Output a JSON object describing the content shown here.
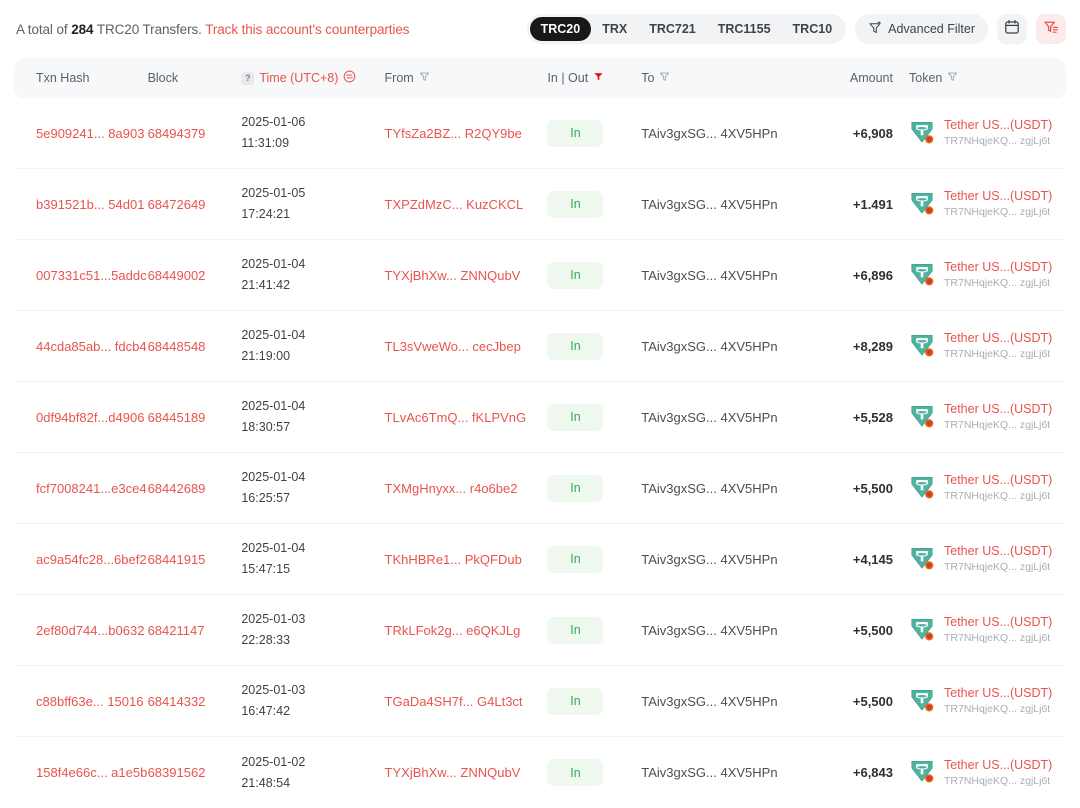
{
  "summary": {
    "prefix": "A total of",
    "count": "284",
    "middle": "TRC20 Transfers.",
    "link": "Track this account's counterparties"
  },
  "toolbar": {
    "tabs": [
      {
        "label": "TRC20",
        "active": true
      },
      {
        "label": "TRX",
        "active": false
      },
      {
        "label": "TRC721",
        "active": false
      },
      {
        "label": "TRC1155",
        "active": false
      },
      {
        "label": "TRC10",
        "active": false
      }
    ],
    "advanced_filter_label": "Advanced Filter",
    "advanced_filter_icon": "funnel-icon",
    "calendar_icon": "calendar-icon",
    "filter_list_icon": "filter-list-icon"
  },
  "colors": {
    "accent_red": "#e8544d",
    "badge_green_bg": "#eef8ef",
    "badge_green_text": "#3aa757",
    "header_bg": "#f7f8f9",
    "tab_active_bg": "#17181a"
  },
  "table": {
    "headers": {
      "txn_hash": "Txn Hash",
      "block": "Block",
      "time": "Time (UTC+8)",
      "time_help": "?",
      "from": "From",
      "in_out": "In | Out",
      "to": "To",
      "amount": "Amount",
      "token": "Token"
    },
    "rows": [
      {
        "hash": "5e909241... 8a903",
        "block": "68494379",
        "date": "2025-01-06",
        "time": "11:31:09",
        "from": "TYfsZa2BZ... R2QY9be",
        "direction": "In",
        "to": "TAiv3gxSG... 4XV5HPn",
        "amount": "+6,908",
        "token_name": "Tether US...(USDT)",
        "token_addr": "TR7NHqjeKQ... zgjLj6t"
      },
      {
        "hash": "b391521b... 54d01",
        "block": "68472649",
        "date": "2025-01-05",
        "time": "17:24:21",
        "from": "TXPZdMzC... KuzCKCL",
        "direction": "In",
        "to": "TAiv3gxSG... 4XV5HPn",
        "amount": "+1.491",
        "token_name": "Tether US...(USDT)",
        "token_addr": "TR7NHqjeKQ... zgjLj6t"
      },
      {
        "hash": "007331c51...5addc",
        "block": "68449002",
        "date": "2025-01-04",
        "time": "21:41:42",
        "from": "TYXjBhXw... ZNNQubV",
        "direction": "In",
        "to": "TAiv3gxSG... 4XV5HPn",
        "amount": "+6,896",
        "token_name": "Tether US...(USDT)",
        "token_addr": "TR7NHqjeKQ... zgjLj6t"
      },
      {
        "hash": "44cda85ab... fdcb4",
        "block": "68448548",
        "date": "2025-01-04",
        "time": "21:19:00",
        "from": "TL3sVweWo... cecJbep",
        "direction": "In",
        "to": "TAiv3gxSG... 4XV5HPn",
        "amount": "+8,289",
        "token_name": "Tether US...(USDT)",
        "token_addr": "TR7NHqjeKQ... zgjLj6t"
      },
      {
        "hash": "0df94bf82f...d4906",
        "block": "68445189",
        "date": "2025-01-04",
        "time": "18:30:57",
        "from": "TLvAc6TmQ... fKLPVnG",
        "direction": "In",
        "to": "TAiv3gxSG... 4XV5HPn",
        "amount": "+5,528",
        "token_name": "Tether US...(USDT)",
        "token_addr": "TR7NHqjeKQ... zgjLj6t"
      },
      {
        "hash": "fcf7008241...e3ce4",
        "block": "68442689",
        "date": "2025-01-04",
        "time": "16:25:57",
        "from": "TXMgHnyxx... r4o6be2",
        "direction": "In",
        "to": "TAiv3gxSG... 4XV5HPn",
        "amount": "+5,500",
        "token_name": "Tether US...(USDT)",
        "token_addr": "TR7NHqjeKQ... zgjLj6t"
      },
      {
        "hash": "ac9a54fc28...6bef2",
        "block": "68441915",
        "date": "2025-01-04",
        "time": "15:47:15",
        "from": "TKhHBRe1... PkQFDub",
        "direction": "In",
        "to": "TAiv3gxSG... 4XV5HPn",
        "amount": "+4,145",
        "token_name": "Tether US...(USDT)",
        "token_addr": "TR7NHqjeKQ... zgjLj6t"
      },
      {
        "hash": "2ef80d744...b0632",
        "block": "68421147",
        "date": "2025-01-03",
        "time": "22:28:33",
        "from": "TRkLFok2g...  e6QKJLg",
        "direction": "In",
        "to": "TAiv3gxSG... 4XV5HPn",
        "amount": "+5,500",
        "token_name": "Tether US...(USDT)",
        "token_addr": "TR7NHqjeKQ... zgjLj6t"
      },
      {
        "hash": "c88bff63e... 15016",
        "block": "68414332",
        "date": "2025-01-03",
        "time": "16:47:42",
        "from": "TGaDa4SH7f... G4Lt3ct",
        "direction": "In",
        "to": "TAiv3gxSG... 4XV5HPn",
        "amount": "+5,500",
        "token_name": "Tether US...(USDT)",
        "token_addr": "TR7NHqjeKQ... zgjLj6t"
      },
      {
        "hash": "158f4e66c... a1e5b",
        "block": "68391562",
        "date": "2025-01-02",
        "time": "21:48:54",
        "from": "TYXjBhXw... ZNNQubV",
        "direction": "In",
        "to": "TAiv3gxSG... 4XV5HPn",
        "amount": "+6,843",
        "token_name": "Tether US...(USDT)",
        "token_addr": "TR7NHqjeKQ... zgjLj6t"
      }
    ]
  }
}
